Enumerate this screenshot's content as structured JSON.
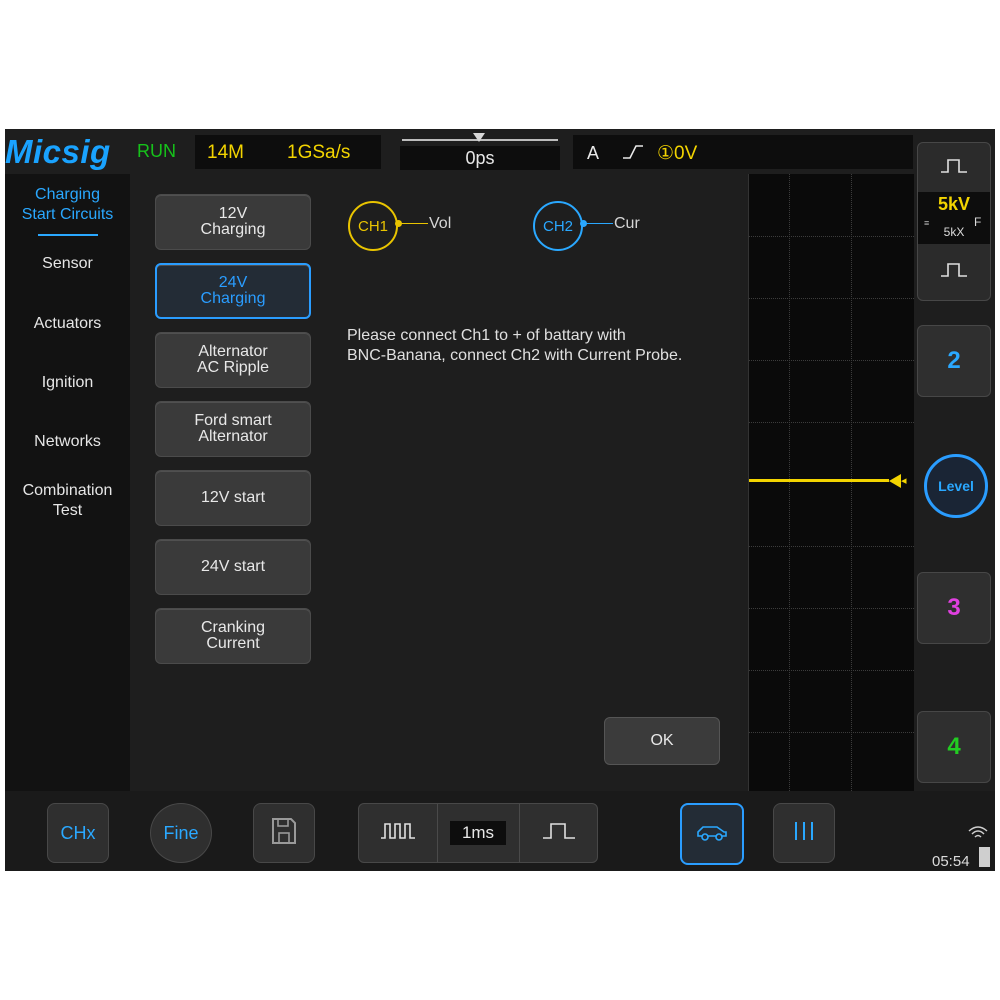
{
  "brand": "Micsig",
  "status": {
    "run": "RUN",
    "memory": "14M",
    "sample_rate": "1GSa/s"
  },
  "timebase": {
    "offset": "0ps"
  },
  "trigger": {
    "source": "A",
    "edge_icon": "rising-edge-icon",
    "level": "①0V"
  },
  "sidebar": {
    "items": [
      {
        "label_line1": "Charging",
        "label_line2": "Start Circuits",
        "active": true
      },
      {
        "label_line1": "Sensor"
      },
      {
        "label_line1": "Actuators"
      },
      {
        "label_line1": "Ignition"
      },
      {
        "label_line1": "Networks"
      },
      {
        "label_line1": "Combination",
        "label_line2": "Test"
      }
    ]
  },
  "tests": [
    {
      "line1": "12V",
      "line2": "Charging"
    },
    {
      "line1": "24V",
      "line2": "Charging",
      "active": true
    },
    {
      "line1": "Alternator",
      "line2": "AC Ripple"
    },
    {
      "line1": "Ford smart",
      "line2": "Alternator"
    },
    {
      "line1": "12V start"
    },
    {
      "line1": "24V start"
    },
    {
      "line1": "Cranking",
      "line2": "Current"
    }
  ],
  "connection": {
    "ch1": {
      "label": "CH1",
      "signal": "Vol",
      "color": "#e9c400"
    },
    "ch2": {
      "label": "CH2",
      "signal": "Cur",
      "color": "#2aa8ff"
    },
    "instruction_line1": "Please connect Ch1 to + of battary with",
    "instruction_line2": "BNC-Banana, connect Ch2 with Current Probe."
  },
  "ok_label": "OK",
  "right_panel": {
    "ch1_scale": "5kV",
    "ch1_probe": "5kX",
    "ch1_coupling": "F",
    "ch2": "2",
    "level": "Level",
    "ch3": "3",
    "ch4": "4",
    "colors": {
      "ch1": "#f3d400",
      "ch2": "#2aa8ff",
      "ch3": "#e040e0",
      "ch4": "#22cc22"
    }
  },
  "bottom": {
    "chx": "CHx",
    "fine": "Fine",
    "save_icon": "floppy-disk-icon",
    "timebase": "1ms",
    "auto_icon": "car-icon",
    "cursor_icon": "cursor-lines-icon",
    "clock": "05:54"
  }
}
